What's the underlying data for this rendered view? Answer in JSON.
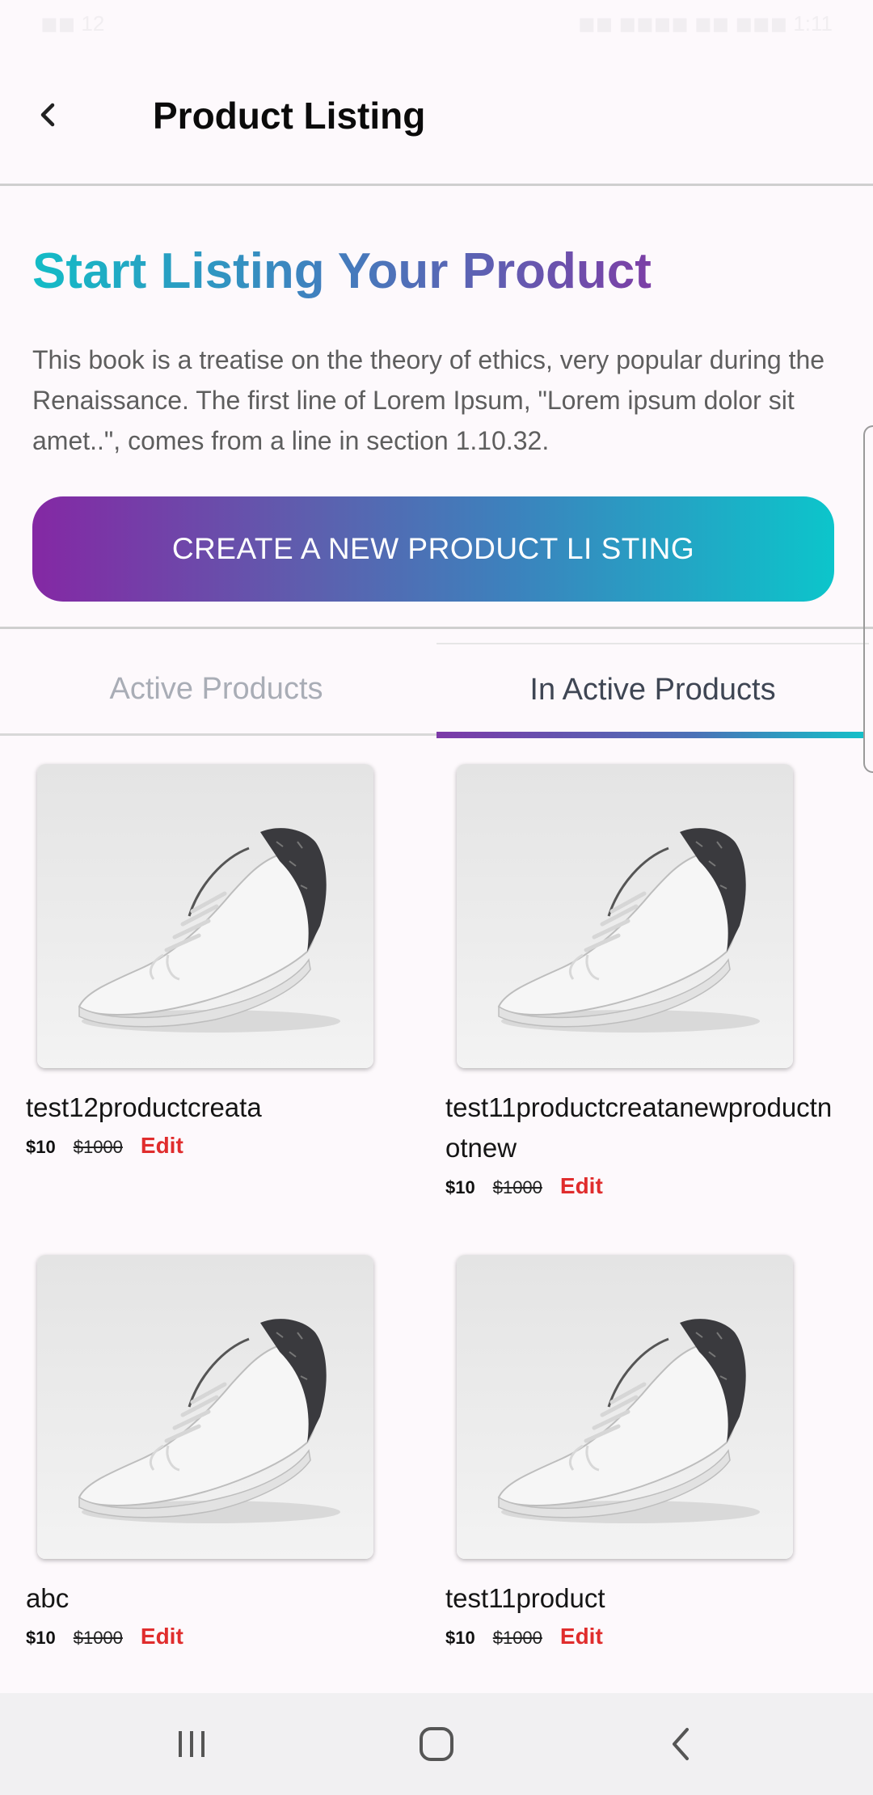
{
  "status_bar": {
    "left": "◼◼ 12",
    "right": "◼◼ ◼◼◼◼ ◼◼ ◼◼◼ 1:11"
  },
  "header": {
    "title": "Product Listing"
  },
  "hero": {
    "title": "Start Listing Your Product",
    "description": "This book is a treatise on the theory of ethics, very popular during the Renaissance. The first line of Lorem Ipsum, \"Lorem ipsum dolor sit amet..\", comes from a line in section 1.10.32.",
    "cta_label": "CREATE A NEW PRODUCT LI STING"
  },
  "tabs": [
    {
      "label": "Active Products",
      "selected": false
    },
    {
      "label": "In Active Products",
      "selected": true
    }
  ],
  "products": [
    {
      "name": "test12productcreata",
      "price": "$10",
      "old_price": "$1000",
      "edit_label": "Edit"
    },
    {
      "name": "test11productcreatanewproductnotnew",
      "price": "$10",
      "old_price": "$1000",
      "edit_label": "Edit"
    },
    {
      "name": "abc",
      "price": "$10",
      "old_price": "$1000",
      "edit_label": "Edit"
    },
    {
      "name": "test11product",
      "price": "$10",
      "old_price": "$1000",
      "edit_label": "Edit"
    }
  ],
  "colors": {
    "gradient_start": "#8428a4",
    "gradient_end": "#0cc5cb",
    "edit_red": "#e02d2d",
    "tab_active_text": "#3f4654",
    "tab_inactive_text": "#a9adb6"
  },
  "icons": {
    "back": "chevron-left-icon",
    "nav_recents": "recents-icon",
    "nav_home": "home-icon",
    "nav_back": "back-icon",
    "product_image": "sneaker-image"
  }
}
